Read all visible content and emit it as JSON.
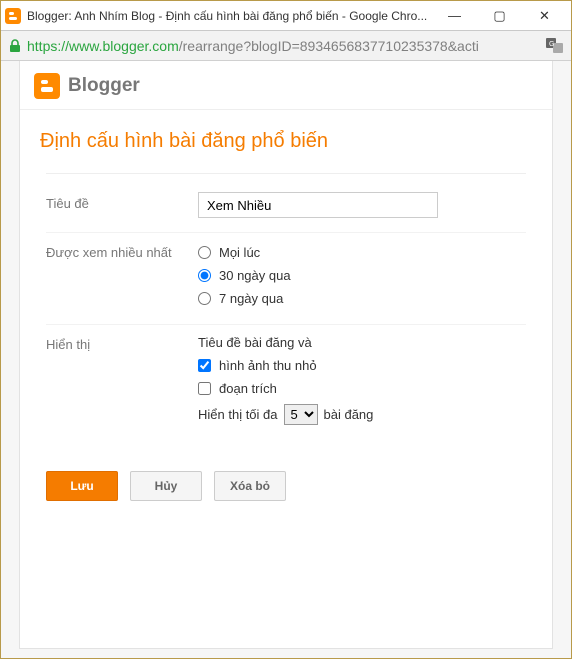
{
  "window": {
    "title": "Blogger: Anh Nhím Blog - Định cấu hình bài đăng phổ biến - Google Chro..."
  },
  "address": {
    "protocol": "https",
    "host": "://www.blogger.com",
    "path": "/rearrange?blogID=8934656837710235378&acti"
  },
  "brand": {
    "name": "Blogger"
  },
  "page": {
    "title": "Định cấu hình bài đăng phổ biến"
  },
  "form": {
    "title_label": "Tiêu đề",
    "title_value": "Xem Nhiều",
    "most_viewed_label": "Được xem nhiều nhất",
    "radio": {
      "all": "Mọi lúc",
      "last30": "30 ngày qua",
      "last7": "7 ngày qua"
    },
    "display_label": "Hiển thị",
    "display": {
      "heading": "Tiêu đề bài đăng và",
      "thumbnail": "hình ảnh thu nhỏ",
      "snippet": "đoạn trích",
      "max_prefix": "Hiển thị tối đa",
      "max_value": "5",
      "max_suffix": "bài đăng"
    }
  },
  "buttons": {
    "save": "Lưu",
    "cancel": "Hủy",
    "remove": "Xóa bỏ"
  }
}
